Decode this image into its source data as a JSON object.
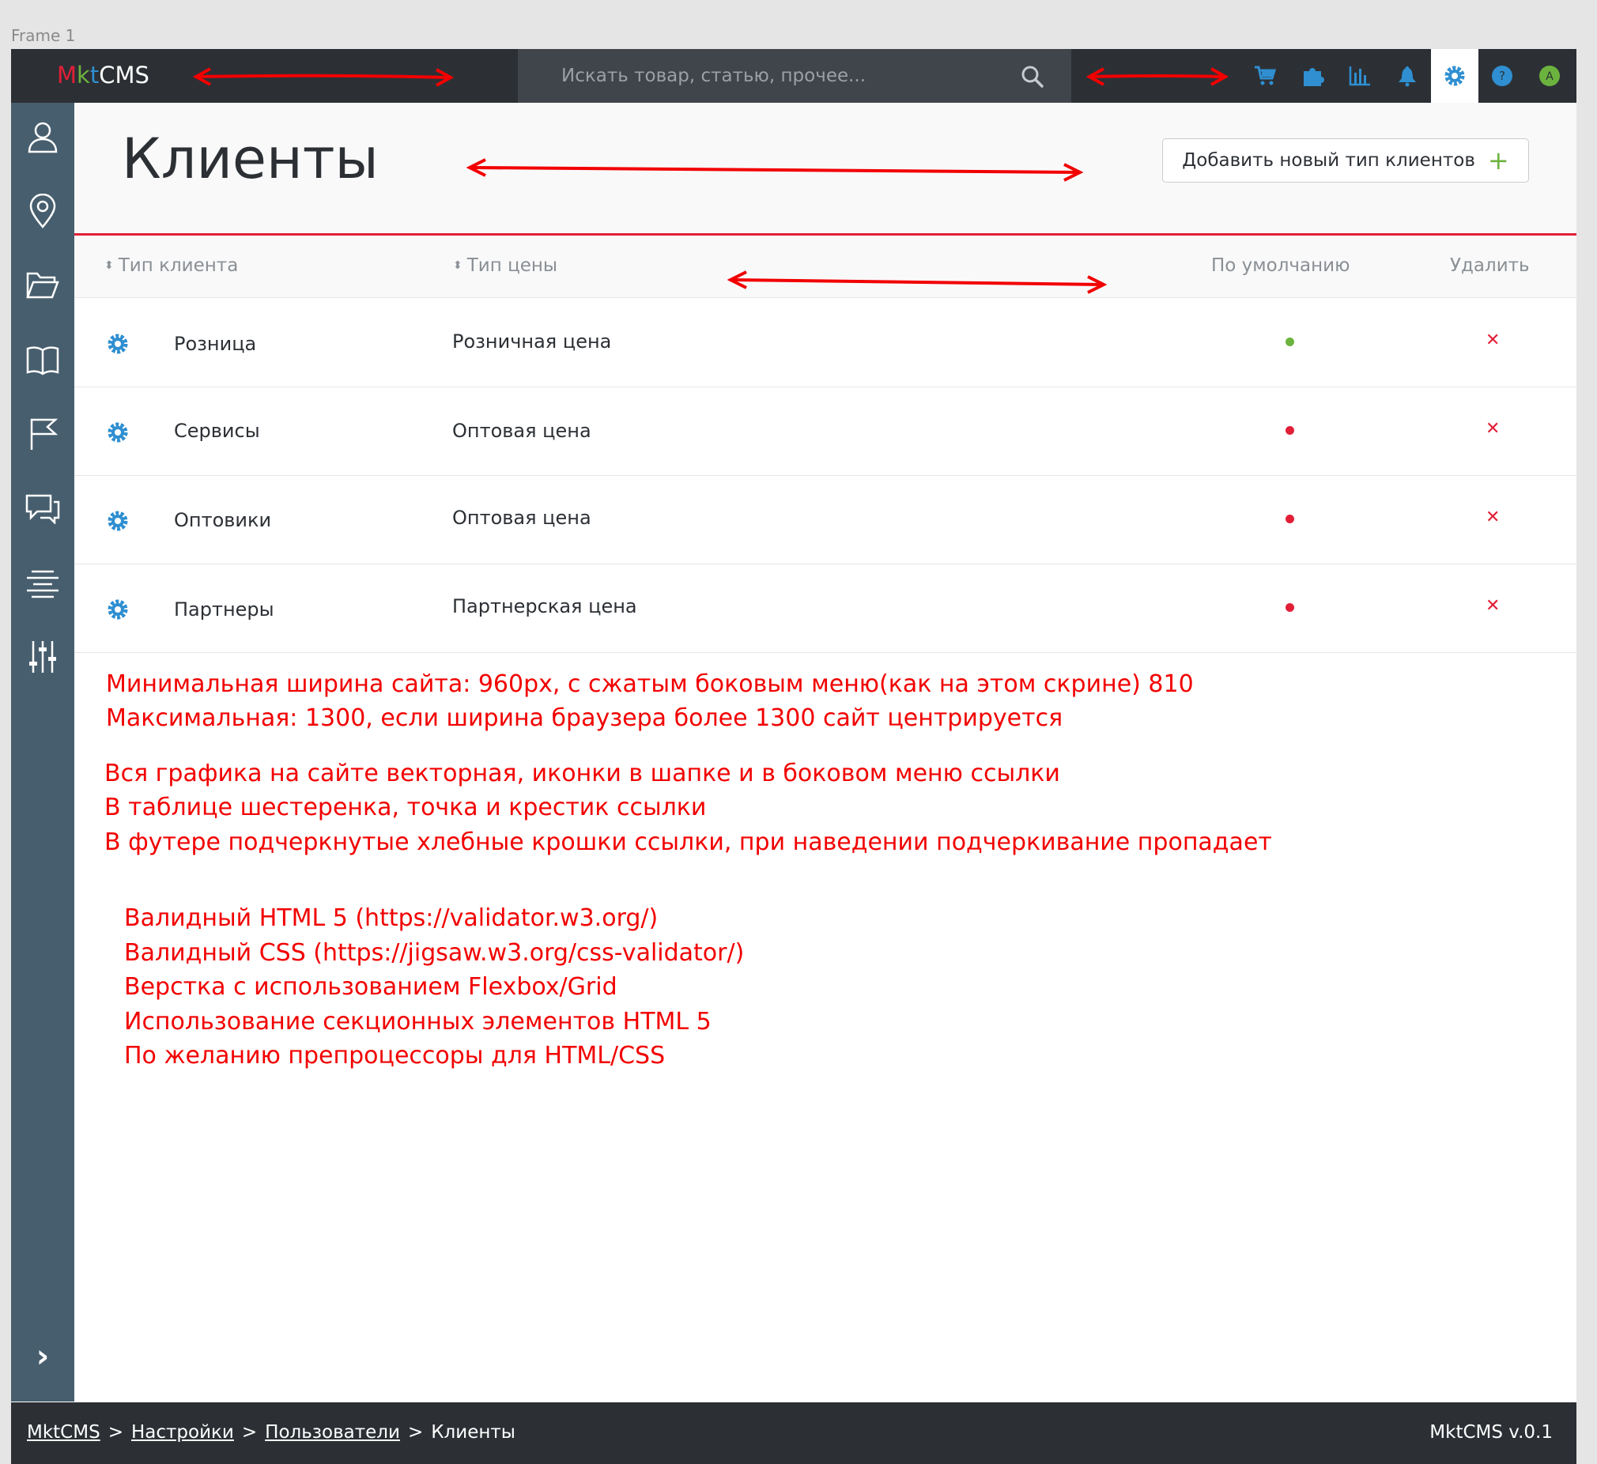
{
  "frame_label": "Frame 1",
  "logo": {
    "m": "M",
    "k": "k",
    "t": "t",
    "rest": "CMS"
  },
  "search": {
    "placeholder": "Искать товар, статью, прочее..."
  },
  "top_icons": [
    "cart-icon",
    "puzzle-icon",
    "chart-icon",
    "bell-icon",
    "gear-icon",
    "help-icon",
    "avatar"
  ],
  "avatar_letter": "A",
  "page": {
    "title": "Клиенты",
    "add_button": "Добавить новый тип клиентов",
    "add_plus": "+"
  },
  "table": {
    "columns": [
      "Тип клиента",
      "Тип цены",
      "По умолчанию",
      "Удалить"
    ],
    "sort_glyph": "⬍",
    "rows": [
      {
        "client_type": "Розница",
        "price_type": "Розничная цена",
        "default": true,
        "delete": "✕"
      },
      {
        "client_type": "Сервисы",
        "price_type": "Оптовая цена",
        "default": false,
        "delete": "✕"
      },
      {
        "client_type": "Оптовики",
        "price_type": "Оптовая цена",
        "default": false,
        "delete": "✕"
      },
      {
        "client_type": "Партнеры",
        "price_type": "Партнерская цена",
        "default": false,
        "delete": "✕"
      }
    ]
  },
  "notes": [
    "Минимальная ширина сайта: 960px, с сжатым боковым меню(как на этом скрине) 810",
    "Максимальная: 1300, если ширина браузера более 1300 сайт центрируется",
    "Вся графика на сайте векторная, иконки в шапке и в боковом меню ссылки",
    "В таблице шестеренка, точка и крестик ссылки",
    "В футере подчеркнутые хлебные крошки ссылки, при наведении подчеркивание пропадает",
    "Валидный HTML 5 (https://validator.w3.org/)",
    "Валидный CSS (https://jigsaw.w3.org/css-validator/)",
    "Верстка с использованием Flexbox/Grid",
    "Использование секционных элементов HTML 5",
    "По желанию препроцессоры для HTML/CSS"
  ],
  "sidebar_icons": [
    "user-icon",
    "location-icon",
    "folder-icon",
    "book-icon",
    "flag-icon",
    "chat-icon",
    "align-icon",
    "sliders-icon"
  ],
  "sidebar_expand": "›",
  "footer": {
    "crumbs": [
      "MktCMS",
      "Настройки",
      "Пользователи"
    ],
    "current": "Клиенты",
    "separator": ">",
    "version": "MktCMS v.0.1"
  },
  "colors": {
    "topbar": "#2c3035",
    "sidebar": "#475e6e",
    "accent_red": "#e21f37",
    "accent_green": "#6cb33e",
    "icon_blue": "#2f8fd1",
    "annotation_red": "#f20000"
  }
}
